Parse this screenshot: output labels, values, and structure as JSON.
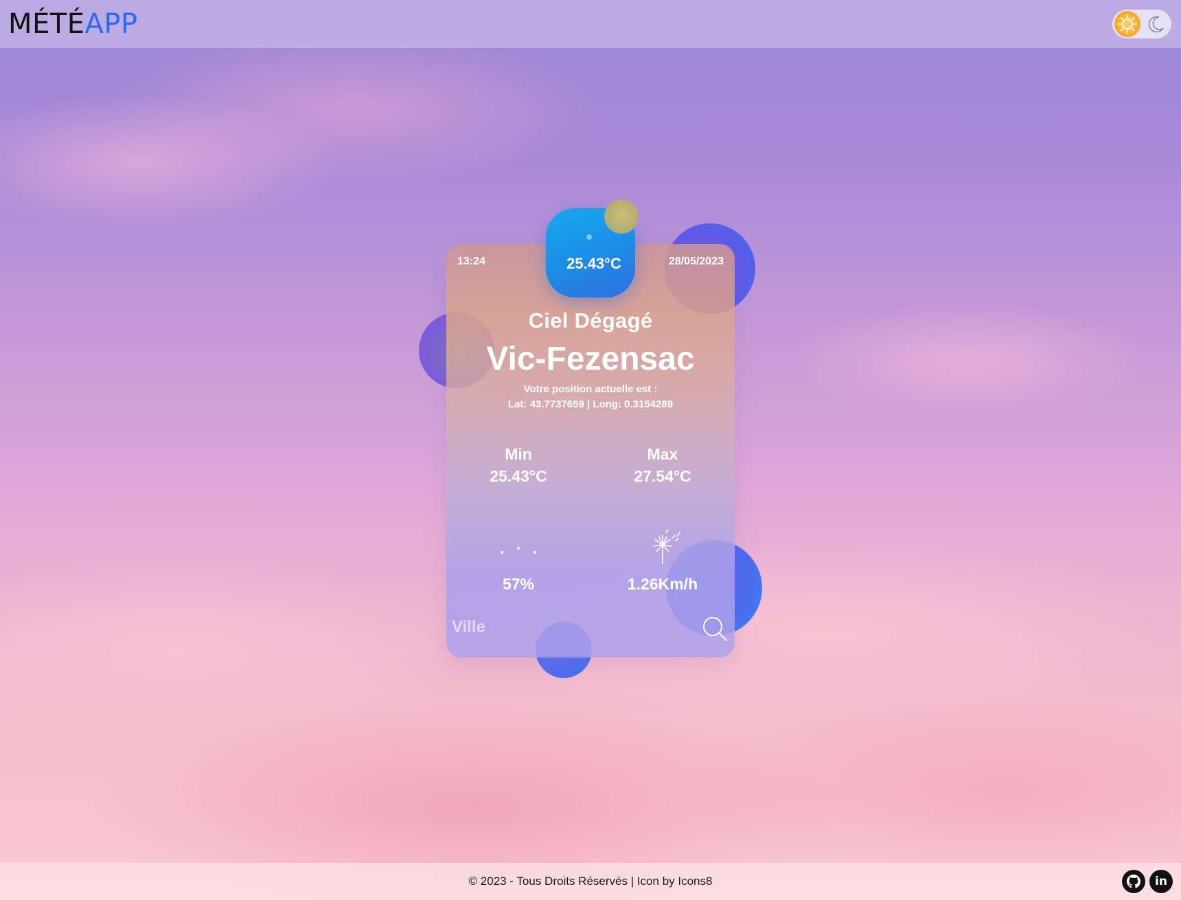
{
  "header": {
    "logo_main": "MÉTÉ",
    "logo_accent": "APP",
    "theme_toggle": {
      "state": "light",
      "sun_icon": "sun-icon",
      "moon_icon": "moon-icon"
    }
  },
  "card": {
    "time": "13:24",
    "date": "28/05/2023",
    "current_temp": "25.43°C",
    "description": "Ciel Dégagé",
    "city": "Vic-Fezensac",
    "position_label": "Votre position actuelle est :",
    "position_coords": "Lat: 43.7737659 | Long: 0.3154289",
    "min_label": "Min",
    "min_value": "25.43°C",
    "max_label": "Max",
    "max_value": "27.54°C",
    "humidity_icon": "humidity-dots-icon",
    "humidity_value": "57%",
    "wind_icon": "dandelion-wind-icon",
    "wind_value": "1.26Km/h",
    "search_placeholder": "Ville",
    "search_icon": "search-icon"
  },
  "footer": {
    "text": "© 2023 - Tous Droits Réservés | Icon by Icons8",
    "github_icon": "github-icon",
    "linkedin_label": "in"
  },
  "colors": {
    "accent": "#2a6bf0",
    "temp_badge": "#1b8fe6",
    "sun": "#f6a623"
  }
}
